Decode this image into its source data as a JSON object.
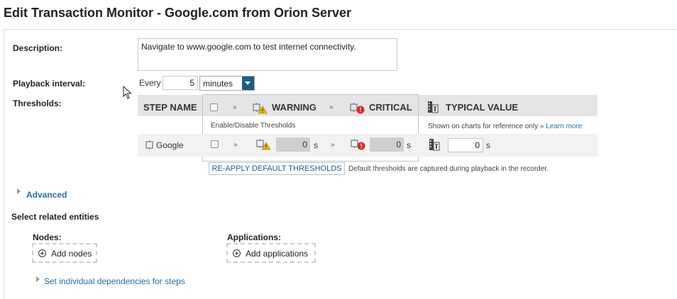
{
  "page": {
    "title": "Edit Transaction Monitor - Google.com from Orion Server"
  },
  "form": {
    "description_label": "Description:",
    "description_value": "Navigate to www.google.com to test internet connectivity.",
    "playback_label": "Playback interval:",
    "every_label": "Every",
    "interval_value": "5",
    "interval_unit": "minutes",
    "thresholds_label": "Thresholds:"
  },
  "thresholds_table": {
    "col_step": "STEP NAME",
    "arrow": "»",
    "col_warning": "WARNING",
    "col_critical": "CRITICAL",
    "col_typical": "TYPICAL VALUE",
    "enable_note": "Enable/Disable Thresholds",
    "typical_note": "Shown on charts for reference only »",
    "learn_more": "Learn more",
    "row": {
      "step_name": "Google",
      "warning_value": "0",
      "critical_value": "0",
      "typical_value": "0",
      "unit": "s"
    },
    "reapply_button": "RE-APPLY DEFAULT THRESHOLDS",
    "reapply_note": "Default thresholds are captured during playback in the recorder."
  },
  "advanced": {
    "label": "Advanced"
  },
  "related": {
    "title": "Select related entities",
    "nodes_label": "Nodes:",
    "add_nodes": "Add nodes",
    "applications_label": "Applications:",
    "add_applications": "Add applications",
    "dependencies_link": "Set individual dependencies for steps"
  },
  "colors": {
    "accent": "#1f5c86",
    "link": "#2b6ea2",
    "warning": "#f2b600",
    "critical": "#d92b2b"
  },
  "icons": [
    "step-icon",
    "warning-icon",
    "critical-icon",
    "typical-value-icon",
    "plus-icon",
    "mouse-cursor-icon"
  ]
}
